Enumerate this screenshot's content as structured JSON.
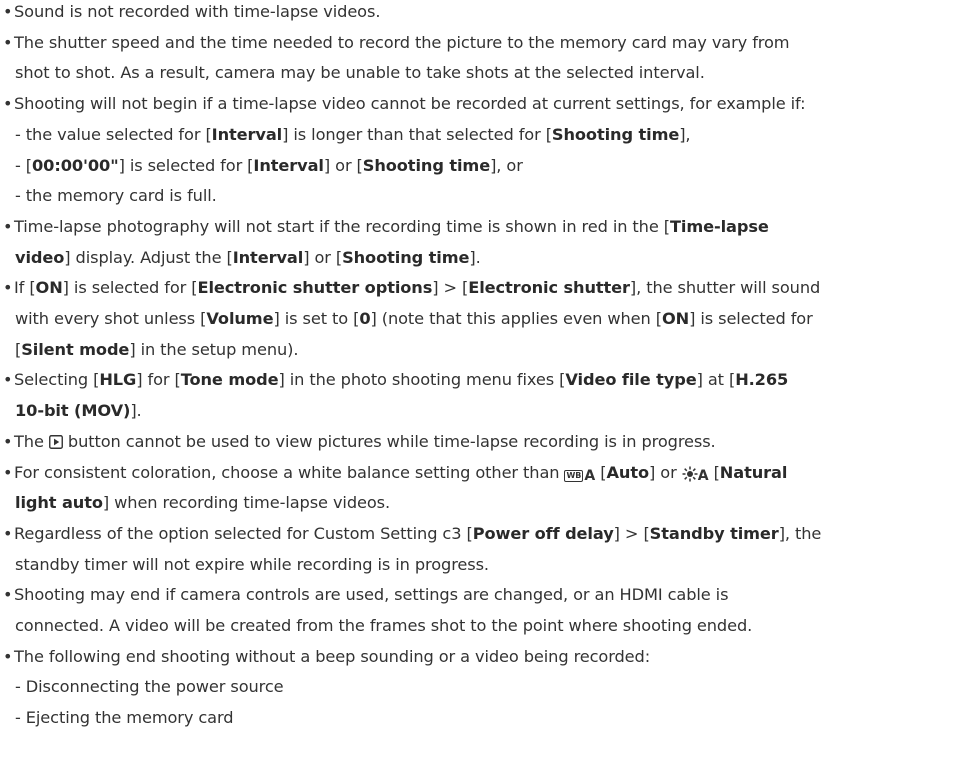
{
  "document": {
    "lines": [
      {
        "id": "l1",
        "type": "bullet",
        "segments": [
          {
            "t": "Sound is not recorded with time-lapse videos."
          }
        ]
      },
      {
        "id": "l2",
        "type": "bullet",
        "segments": [
          {
            "t": "The shutter speed and the time needed to record the picture to the memory card may vary from"
          }
        ]
      },
      {
        "id": "l3",
        "type": "cont",
        "segments": [
          {
            "t": "shot to shot. As a result, camera may be unable to take shots at the selected interval."
          }
        ]
      },
      {
        "id": "l4",
        "type": "bullet",
        "segments": [
          {
            "t": "Shooting will not begin if a time-lapse video cannot be recorded at current settings, for example if:"
          }
        ]
      },
      {
        "id": "l5",
        "type": "sub",
        "segments": [
          {
            "t": "- the value selected for ["
          },
          {
            "t": "Interval",
            "b": true
          },
          {
            "t": "] is longer than that selected for ["
          },
          {
            "t": "Shooting time",
            "b": true
          },
          {
            "t": "],"
          }
        ]
      },
      {
        "id": "l6",
        "type": "sub",
        "segments": [
          {
            "t": "- ["
          },
          {
            "t": "00:00'00\"",
            "b": true
          },
          {
            "t": "] is selected for ["
          },
          {
            "t": "Interval",
            "b": true
          },
          {
            "t": "] or ["
          },
          {
            "t": "Shooting time",
            "b": true
          },
          {
            "t": "], or"
          }
        ]
      },
      {
        "id": "l7",
        "type": "sub",
        "segments": [
          {
            "t": "- the memory card is full."
          }
        ]
      },
      {
        "id": "l8",
        "type": "bullet",
        "segments": [
          {
            "t": "Time-lapse photography will not start if the recording time is shown in red in the ["
          },
          {
            "t": "Time-lapse",
            "b": true
          }
        ]
      },
      {
        "id": "l9",
        "type": "cont",
        "segments": [
          {
            "t": "video",
            "b": true
          },
          {
            "t": "] display. Adjust the ["
          },
          {
            "t": "Interval",
            "b": true
          },
          {
            "t": "] or ["
          },
          {
            "t": "Shooting time",
            "b": true
          },
          {
            "t": "]."
          }
        ]
      },
      {
        "id": "l10",
        "type": "bullet",
        "segments": [
          {
            "t": "If ["
          },
          {
            "t": "ON",
            "b": true
          },
          {
            "t": "] is selected for ["
          },
          {
            "t": "Electronic shutter options",
            "b": true
          },
          {
            "t": "] > ["
          },
          {
            "t": "Electronic shutter",
            "b": true
          },
          {
            "t": "], the shutter will sound"
          }
        ]
      },
      {
        "id": "l11",
        "type": "cont",
        "segments": [
          {
            "t": "with every shot unless ["
          },
          {
            "t": "Volume",
            "b": true
          },
          {
            "t": "] is set to ["
          },
          {
            "t": "0",
            "b": true
          },
          {
            "t": "] (note that this applies even when ["
          },
          {
            "t": "ON",
            "b": true
          },
          {
            "t": "] is selected for"
          }
        ]
      },
      {
        "id": "l12",
        "type": "cont",
        "segments": [
          {
            "t": "["
          },
          {
            "t": "Silent mode",
            "b": true
          },
          {
            "t": "] in the setup menu)."
          }
        ]
      },
      {
        "id": "l13",
        "type": "bullet",
        "segments": [
          {
            "t": "Selecting ["
          },
          {
            "t": "HLG",
            "b": true
          },
          {
            "t": "] for ["
          },
          {
            "t": "Tone mode",
            "b": true
          },
          {
            "t": "] in the photo shooting menu fixes ["
          },
          {
            "t": "Video file type",
            "b": true
          },
          {
            "t": "] at ["
          },
          {
            "t": "H.265",
            "b": true
          }
        ]
      },
      {
        "id": "l14",
        "type": "cont",
        "segments": [
          {
            "t": "10-bit (MOV)",
            "b": true
          },
          {
            "t": "]."
          }
        ]
      },
      {
        "id": "l15",
        "type": "bullet",
        "segments": [
          {
            "t": "The "
          },
          {
            "icon": "playback-button-icon"
          },
          {
            "t": " button cannot be used to view pictures while time-lapse recording is in progress."
          }
        ]
      },
      {
        "id": "l16",
        "type": "bullet",
        "segments": [
          {
            "t": "For consistent coloration, choose a white balance setting other than "
          },
          {
            "icon": "wb-auto-icon"
          },
          {
            "t": " ["
          },
          {
            "t": "Auto",
            "b": true
          },
          {
            "t": "] or "
          },
          {
            "icon": "natural-light-auto-icon"
          },
          {
            "t": " ["
          },
          {
            "t": "Natural",
            "b": true
          }
        ]
      },
      {
        "id": "l17",
        "type": "cont",
        "segments": [
          {
            "t": "light auto",
            "b": true
          },
          {
            "t": "] when recording time-lapse videos."
          }
        ]
      },
      {
        "id": "l18",
        "type": "bullet",
        "segments": [
          {
            "t": "Regardless of the option selected for Custom Setting c3 ["
          },
          {
            "t": "Power off delay",
            "b": true
          },
          {
            "t": "] > ["
          },
          {
            "t": "Standby timer",
            "b": true
          },
          {
            "t": "], the"
          }
        ]
      },
      {
        "id": "l19",
        "type": "cont",
        "segments": [
          {
            "t": "standby timer will not expire while recording is in progress."
          }
        ]
      },
      {
        "id": "l20",
        "type": "bullet",
        "segments": [
          {
            "t": "Shooting may end if camera controls are used, settings are changed, or an HDMI cable is"
          }
        ]
      },
      {
        "id": "l21",
        "type": "cont",
        "segments": [
          {
            "t": "connected. A video will be created from the frames shot to the point where shooting ended."
          }
        ]
      },
      {
        "id": "l22",
        "type": "bullet",
        "segments": [
          {
            "t": "The following end shooting without a beep sounding or a video being recorded:"
          }
        ]
      },
      {
        "id": "l23",
        "type": "sub",
        "segments": [
          {
            "t": "- Disconnecting the power source"
          }
        ]
      },
      {
        "id": "l24",
        "type": "sub",
        "segments": [
          {
            "t": "- Ejecting the memory card"
          }
        ]
      }
    ]
  }
}
